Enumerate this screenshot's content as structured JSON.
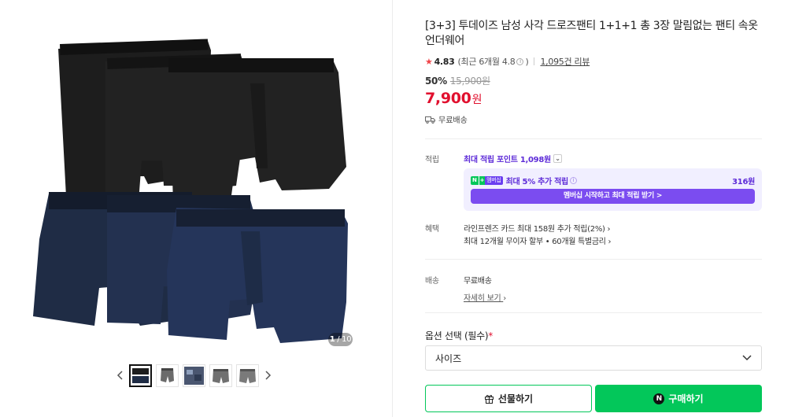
{
  "gallery": {
    "counter_current": "1",
    "counter_total": " / 10",
    "thumbnails": [
      "thumbnail-1",
      "thumbnail-2",
      "thumbnail-3",
      "thumbnail-4",
      "thumbnail-5"
    ],
    "colors": {
      "black": "#1b1b1b",
      "black_band": "#111111",
      "navy": "#1e2b44",
      "navy_band": "#141c2c"
    }
  },
  "product": {
    "title": "[3+3] 투데이즈 남성 사각 드로즈팬티 1+1+1 총 3장 말림없는 팬티 속옷 언더웨어",
    "rating": "4.83",
    "rating_recent": "(최근 6개월 4.8",
    "rating_recent_close": ")",
    "reviews": "1,095건 리뷰",
    "discount": "50%",
    "original_price": "15,900원",
    "price": "7,900",
    "price_unit": "원",
    "shipping_badge": "무료배송"
  },
  "points": {
    "label": "적립",
    "max_points": "최대 적립 포인트 1,098원",
    "membership": {
      "npay_n": "N",
      "npay_plus": "+",
      "npay_member": "멤버십",
      "text": "최대 5% 추가 적립",
      "amount": "316원",
      "button": "멤버십 시작하고 최대 적립 받기 >"
    }
  },
  "benefits": {
    "label": "혜택",
    "line1": "라인프렌즈 카드 최대 158원 추가 적립(2%)",
    "line2": "최대 12개월 무이자 할부 • 60개월 특별금리"
  },
  "delivery": {
    "label": "배송",
    "value": "무료배송",
    "detail_link": "자세히 보기"
  },
  "options": {
    "label": "옵션 선택 (필수)",
    "required_mark": "*",
    "select_value": "사이즈"
  },
  "actions": {
    "gift": "선물하기",
    "buy_icon": "N",
    "buy": "구매하기"
  },
  "theme": {
    "accent_green": "#03c75a",
    "accent_purple": "#5d2bd8",
    "price_red": "#e1102e"
  }
}
